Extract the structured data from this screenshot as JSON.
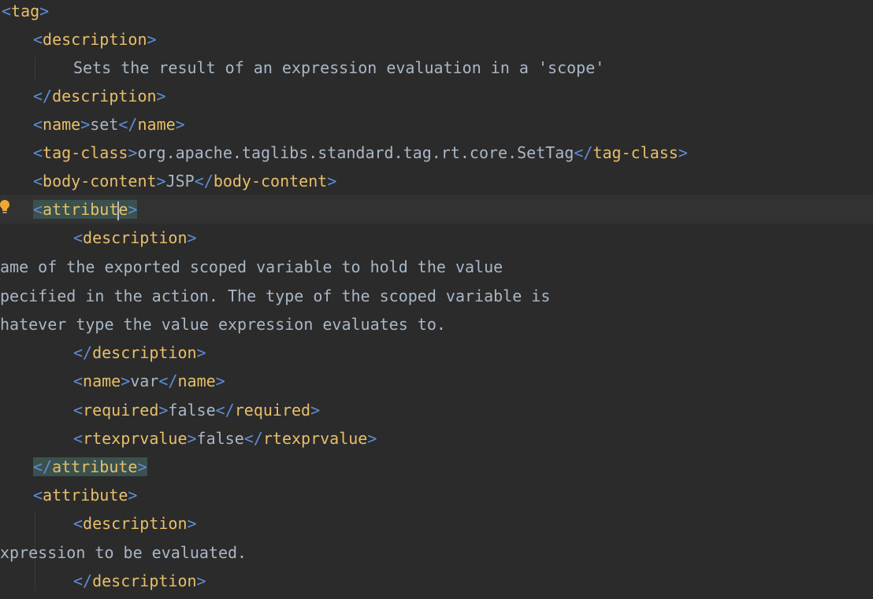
{
  "editor": {
    "lines": {
      "l1": {
        "open": "<",
        "name": "tag",
        "close": ">"
      },
      "l2": {
        "open": "<",
        "name": "description",
        "close": ">"
      },
      "l3": {
        "text": "Sets the result of an expression evaluation in a 'scope'"
      },
      "l4": {
        "open": "</",
        "name": "description",
        "close": ">"
      },
      "l5": {
        "open1": "<",
        "name1": "name",
        "close1": ">",
        "text": "set",
        "open2": "</",
        "name2": "name",
        "close2": ">"
      },
      "l6": {
        "open1": "<",
        "name1": "tag-class",
        "close1": ">",
        "text": "org.apache.taglibs.standard.tag.rt.core.SetTag",
        "open2": "</",
        "name2": "tag-class",
        "close2": ">"
      },
      "l7": {
        "open1": "<",
        "name1": "body-content",
        "close1": ">",
        "text": "JSP",
        "open2": "</",
        "name2": "body-content",
        "close2": ">"
      },
      "l8": {
        "open": "<",
        "name_a": "attribut",
        "name_b": "e",
        "close": ">"
      },
      "l9": {
        "open": "<",
        "name": "description",
        "close": ">"
      },
      "l10": {
        "text": "ame of the exported scoped variable to hold the value"
      },
      "l11": {
        "text": "pecified in the action. The type of the scoped variable is"
      },
      "l12": {
        "text": "hatever type the value expression evaluates to."
      },
      "l13": {
        "open": "</",
        "name": "description",
        "close": ">"
      },
      "l14": {
        "open1": "<",
        "name1": "name",
        "close1": ">",
        "text": "var",
        "open2": "</",
        "name2": "name",
        "close2": ">"
      },
      "l15": {
        "open1": "<",
        "name1": "required",
        "close1": ">",
        "text": "false",
        "open2": "</",
        "name2": "required",
        "close2": ">"
      },
      "l16": {
        "open1": "<",
        "name1": "rtexprvalue",
        "close1": ">",
        "text": "false",
        "open2": "</",
        "name2": "rtexprvalue",
        "close2": ">"
      },
      "l17": {
        "open": "</",
        "name": "attribute",
        "close": ">"
      },
      "l18": {
        "open": "<",
        "name": "attribute",
        "close": ">"
      },
      "l19": {
        "open": "<",
        "name": "description",
        "close": ">"
      },
      "l20": {
        "text": "xpression to be evaluated."
      },
      "l21": {
        "open": "</",
        "name": "description",
        "close": ">"
      }
    },
    "colors": {
      "background": "#2b2b2b",
      "bracket": "#5f8dd6",
      "tag_name": "#e8bf6a",
      "text": "#a9b7c6",
      "match_highlight": "#3b514d",
      "current_line": "#323232"
    },
    "gutter_icon": "lightbulb-icon"
  }
}
